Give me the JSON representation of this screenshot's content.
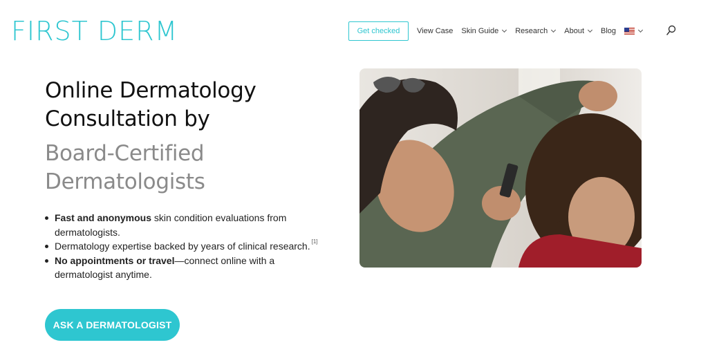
{
  "header": {
    "logo": "FIRST DERM",
    "get_checked": "Get checked",
    "nav": [
      {
        "label": "View Case",
        "dropdown": false
      },
      {
        "label": "Skin Guide",
        "dropdown": true
      },
      {
        "label": "Research",
        "dropdown": true
      },
      {
        "label": "About",
        "dropdown": true
      },
      {
        "label": "Blog",
        "dropdown": false
      }
    ],
    "language_icon": "us-flag-icon",
    "search_icon": "search-icon"
  },
  "hero": {
    "title_line1": "Online Dermatology",
    "title_line2": "Consultation by",
    "subtitle_line1": "Board-Certified",
    "subtitle_line2": "Dermatologists",
    "bullets": [
      {
        "bold": "Fast and anonymous",
        "text": " skin condition evaluations from dermatologists."
      },
      {
        "bold": "",
        "text": "Dermatology expertise backed by years of clinical research.",
        "ref": "[1]"
      },
      {
        "bold": "No appointments or travel",
        "text": "—connect online with a dermatologist anytime."
      }
    ],
    "cta": "ASK A DERMATOLOGIST"
  },
  "colors": {
    "accent": "#2ec6d0",
    "title": "#111111",
    "subtitle": "#8a8a8a"
  }
}
